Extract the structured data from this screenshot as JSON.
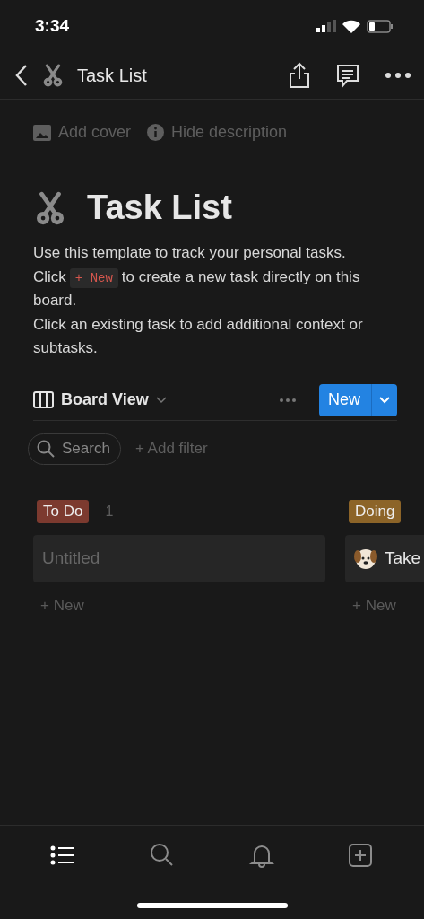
{
  "status_bar": {
    "time": "3:34"
  },
  "nav": {
    "title": "Task List"
  },
  "page_actions": [
    {
      "kind": "cover",
      "label": "Add cover"
    },
    {
      "kind": "info",
      "label": "Hide description"
    }
  ],
  "page": {
    "title": "Task List",
    "description": [
      {
        "text": "Use this template to track your personal tasks."
      },
      {
        "before": "Click",
        "chip": "+ New",
        "after": "to create a new task directly on this board."
      },
      {
        "text": "Click an existing task to add additional context or subtasks."
      }
    ]
  },
  "view": {
    "label": "Board View",
    "new_button": "New"
  },
  "filters": {
    "search": "Search",
    "add_filter": "+ Add filter"
  },
  "columns": [
    {
      "label": "To Do",
      "color": "#7c3a2f",
      "count": "1",
      "cards": [
        {
          "title": "Untitled",
          "empty": true,
          "emoji": false
        }
      ],
      "add": "+ New"
    },
    {
      "label": "Doing",
      "color": "#8c6428",
      "cards": [
        {
          "title": "Take",
          "empty": false,
          "emoji": true
        }
      ],
      "add": "+ New"
    }
  ],
  "tab_bar": [
    {
      "kind": "list",
      "selected": true
    },
    {
      "kind": "search",
      "selected": false
    },
    {
      "kind": "bell",
      "selected": false
    },
    {
      "kind": "add",
      "selected": false
    }
  ]
}
